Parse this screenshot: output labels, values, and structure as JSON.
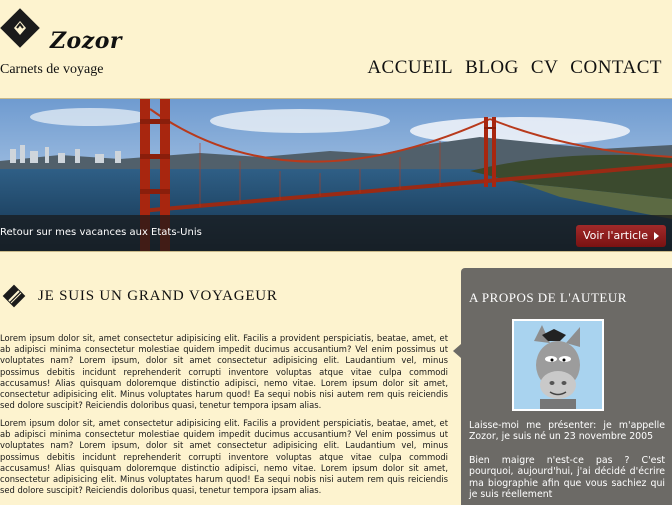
{
  "header": {
    "brand": "Zozor",
    "tagline": "Carnets de voyage",
    "nav": [
      "ACCUEIL",
      "BLOG",
      "CV",
      "CONTACT"
    ]
  },
  "banner": {
    "caption": "Retour sur mes vacances aux Etats-Unis",
    "button_label": "Voir l'article"
  },
  "main": {
    "title": "JE SUIS UN GRAND VOYAGEUR",
    "paragraphs": [
      "Lorem ipsum dolor sit, amet consectetur adipisicing elit. Facilis a provident perspiciatis, beatae, amet, et ab adipisci minima consectetur molestiae quidem impedit ducimus accusantium? Vel enim possimus ut voluptates nam? Lorem ipsum, dolor sit amet consectetur adipisicing elit. Laudantium vel, minus possimus debitis incidunt reprehenderit corrupti inventore voluptas atque vitae culpa commodi accusamus! Alias quisquam doloremque distinctio adipisci, nemo vitae. Lorem ipsum dolor sit amet, consectetur adipisicing elit. Minus voluptates harum quod! Ea sequi nobis nisi autem rem quis reiciendis sed dolore suscipit? Reiciendis doloribus quasi, tenetur tempora ipsam alias.",
      "Lorem ipsum dolor sit, amet consectetur adipisicing elit. Facilis a provident perspiciatis, beatae, amet, et ab adipisci minima consectetur molestiae quidem impedit ducimus accusantium? Vel enim possimus ut voluptates nam? Lorem ipsum, dolor sit amet consectetur adipisicing elit. Laudantium vel, minus possimus debitis incidunt reprehenderit corrupti inventore voluptas atque vitae culpa commodi accusamus! Alias quisquam doloremque distinctio adipisci, nemo vitae. Lorem ipsum dolor sit amet, consectetur adipisicing elit. Minus voluptates harum quod! Ea sequi nobis nisi autem rem quis reiciendis sed dolore suscipit? Reiciendis doloribus quasi, tenetur tempora ipsam alias."
    ]
  },
  "sidebar": {
    "title": "A PROPOS DE L'AUTEUR",
    "paragraphs": [
      "Laisse-moi me présenter: je m'appelle Zozor, je suis né un 23 novembre 2005",
      "Bien maigre n'est-ce pas ? C'est pourquoi, aujourd'hui, j'ai décidé d'écrire ma biographie afin que vous sachiez qui je suis réellement"
    ]
  },
  "colors": {
    "page_background": "#fdf3cf",
    "sidebar_background": "#6c6a66",
    "button_red": "#8c1c1c"
  },
  "icons": {
    "logo": "zozor-logo-icon",
    "section": "pen-icon"
  }
}
